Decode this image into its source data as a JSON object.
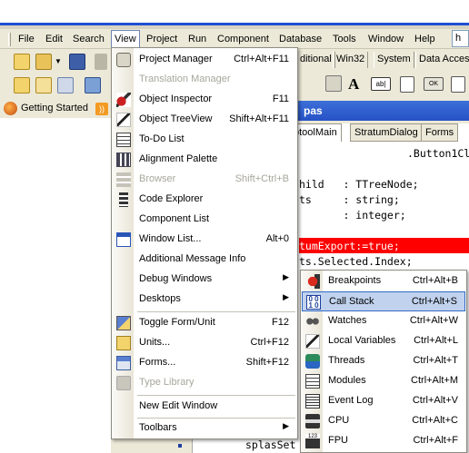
{
  "menubar": {
    "items": [
      "File",
      "Edit",
      "Search",
      "View",
      "Project",
      "Run",
      "Component",
      "Database",
      "Tools",
      "Window",
      "Help"
    ],
    "active": "View",
    "extra_box": "h"
  },
  "palette_tabs": [
    "ditional",
    "Win32",
    "System",
    "Data Acces"
  ],
  "getting_started": {
    "label": "Getting Started"
  },
  "editor": {
    "title": "pas",
    "tabs": [
      "ptoolMain",
      "StratumDialog",
      "Forms"
    ],
    "lines": [
      ".Button1Cl",
      "hild   : TTreeNode;",
      "ts     : string;",
      "       : integer;",
      "tumExport:=true;",
      "ts.Selected.Index;",
      "splasSet"
    ]
  },
  "view_menu": {
    "items": [
      {
        "label": "Project Manager",
        "shortcut": "Ctrl+Alt+F11",
        "icon": "project-manager-icon"
      },
      {
        "label": "Translation Manager",
        "shortcut": "",
        "disabled": true
      },
      {
        "label": "Object Inspector",
        "shortcut": "F11",
        "icon": "object-inspector-icon"
      },
      {
        "label": "Object TreeView",
        "shortcut": "Shift+Alt+F11",
        "icon": "object-treeview-icon"
      },
      {
        "label": "To-Do List",
        "shortcut": "",
        "icon": "todo-list-icon"
      },
      {
        "label": "Alignment Palette",
        "shortcut": "",
        "icon": "alignment-palette-icon"
      },
      {
        "label": "Browser",
        "shortcut": "Shift+Ctrl+B",
        "disabled": true,
        "icon": "browser-icon"
      },
      {
        "label": "Code Explorer",
        "shortcut": "",
        "icon": "code-explorer-icon"
      },
      {
        "label": "Component List",
        "shortcut": ""
      },
      {
        "label": "Window List...",
        "shortcut": "Alt+0",
        "icon": "window-list-icon"
      },
      {
        "label": "Additional Message Info",
        "shortcut": ""
      },
      {
        "label": "Debug Windows",
        "shortcut": "",
        "submenu": true
      },
      {
        "label": "Desktops",
        "shortcut": "",
        "submenu": true
      },
      {
        "label": "Toggle Form/Unit",
        "shortcut": "F12",
        "icon": "toggle-form-unit-icon"
      },
      {
        "label": "Units...",
        "shortcut": "Ctrl+F12",
        "icon": "units-icon"
      },
      {
        "label": "Forms...",
        "shortcut": "Shift+F12",
        "icon": "forms-icon"
      },
      {
        "label": "Type Library",
        "shortcut": "",
        "disabled": true,
        "icon": "type-library-icon"
      },
      {
        "label": "New Edit Window",
        "shortcut": ""
      },
      {
        "label": "Toolbars",
        "shortcut": "",
        "submenu": true
      }
    ]
  },
  "debug_menu": {
    "items": [
      {
        "label": "Breakpoints",
        "shortcut": "Ctrl+Alt+B",
        "icon": "breakpoints-icon"
      },
      {
        "label": "Call Stack",
        "shortcut": "Ctrl+Alt+S",
        "icon": "call-stack-icon",
        "highlighted": true
      },
      {
        "label": "Watches",
        "shortcut": "Ctrl+Alt+W",
        "icon": "watches-icon"
      },
      {
        "label": "Local Variables",
        "shortcut": "Ctrl+Alt+L",
        "icon": "local-variables-icon"
      },
      {
        "label": "Threads",
        "shortcut": "Ctrl+Alt+T",
        "icon": "threads-icon"
      },
      {
        "label": "Modules",
        "shortcut": "Ctrl+Alt+M",
        "icon": "modules-icon"
      },
      {
        "label": "Event Log",
        "shortcut": "Ctrl+Alt+V",
        "icon": "event-log-icon"
      },
      {
        "label": "CPU",
        "shortcut": "Ctrl+Alt+C",
        "icon": "cpu-icon"
      },
      {
        "label": "FPU",
        "shortcut": "Ctrl+Alt+F",
        "icon": "fpu-icon"
      }
    ]
  },
  "colors": {
    "highlight_fill": "#c1d2ee",
    "highlight_border": "#316ac5",
    "error_line": "#ff0000",
    "title_blue": "#2752c6"
  }
}
